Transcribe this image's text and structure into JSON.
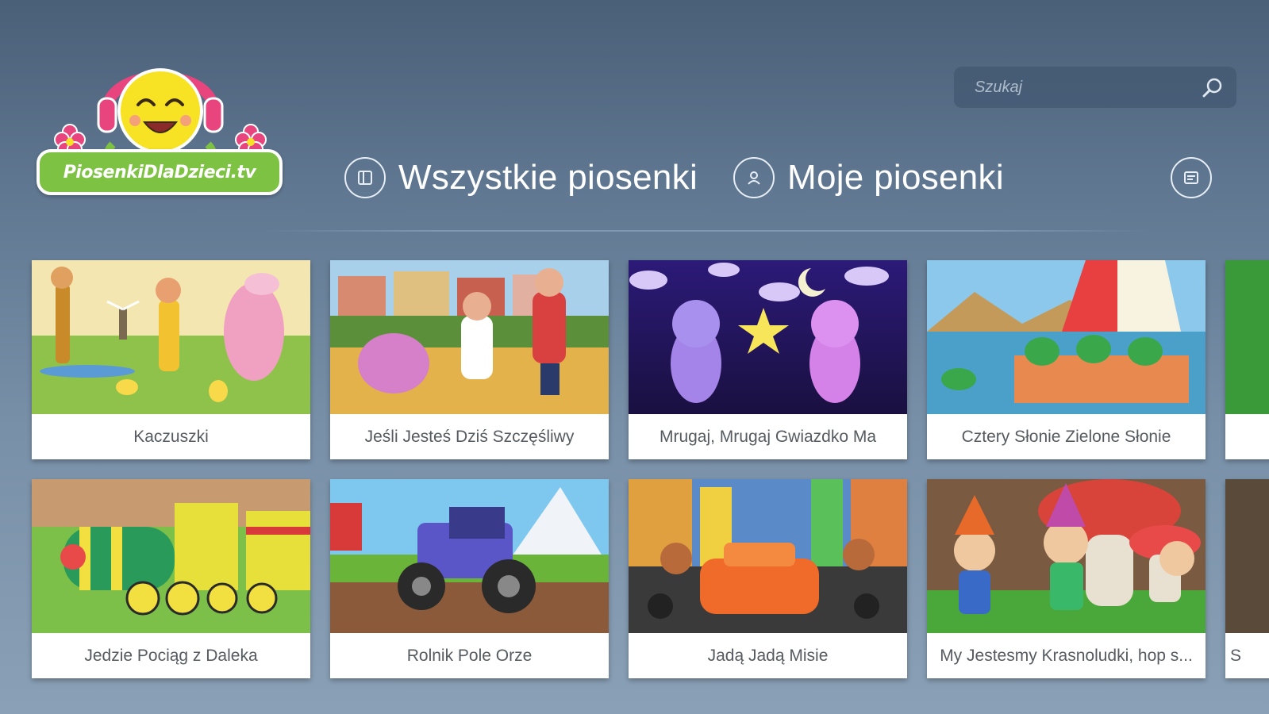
{
  "logo": {
    "text": "PiosenkiDlaDzieci.tv",
    "colors": {
      "green": "#7dc242",
      "pink": "#e8457f",
      "yellow": "#f7e223"
    }
  },
  "search": {
    "placeholder": "Szukaj",
    "value": "",
    "icon": "search-icon"
  },
  "nav": {
    "items": [
      {
        "label": "Wszystkie piosenki",
        "icon": "list-icon"
      },
      {
        "label": "Moje piosenki",
        "icon": "user-icon"
      }
    ],
    "right_icon": "settings-icon"
  },
  "songs": [
    {
      "title": "Kaczuszki",
      "scene": "farm-ducks"
    },
    {
      "title": "Jeśli Jesteś Dziś Szczęśliwy",
      "scene": "kids-elephant"
    },
    {
      "title": "Mrugaj, Mrugaj Gwiazdko Ma",
      "scene": "night-stars"
    },
    {
      "title": "Cztery Słonie Zielone Słonie",
      "scene": "boat-elephants"
    },
    {
      "title": "",
      "scene": "partial"
    },
    {
      "title": "Jedzie Pociąg z Daleka",
      "scene": "train"
    },
    {
      "title": "Rolnik Pole Orze",
      "scene": "tractor"
    },
    {
      "title": "Jadą Jadą Misie",
      "scene": "city-car"
    },
    {
      "title": "My Jestesmy Krasnoludki, hop s...",
      "scene": "dwarves"
    },
    {
      "title": "S",
      "scene": "partial"
    }
  ]
}
